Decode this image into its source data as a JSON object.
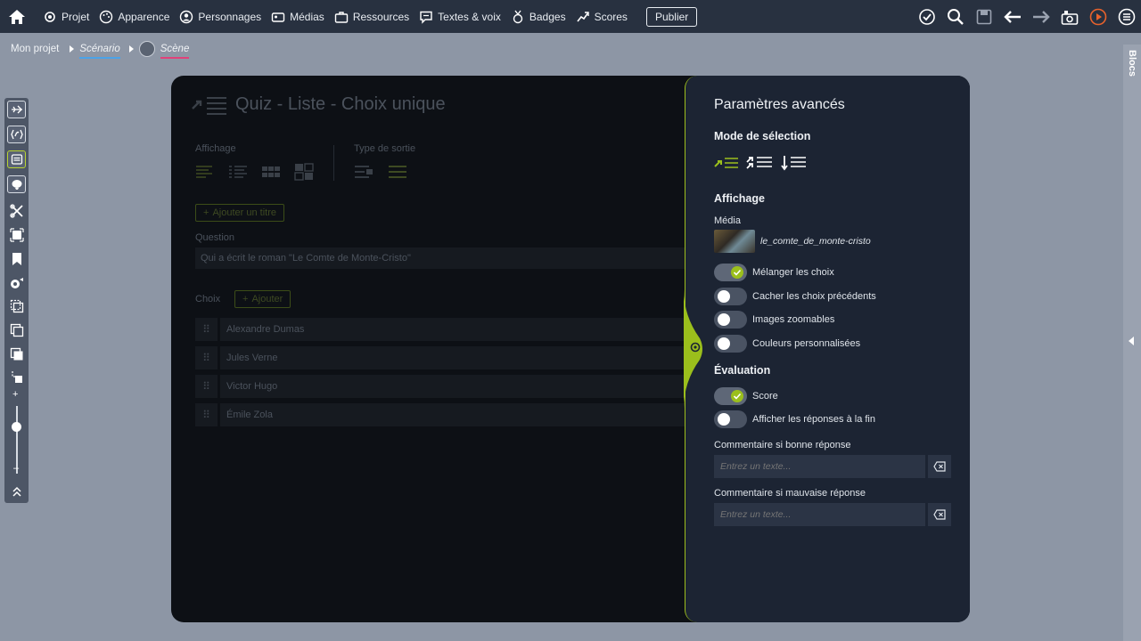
{
  "topbar": {
    "items": [
      {
        "label": "Projet",
        "icon": "gear-icon"
      },
      {
        "label": "Apparence",
        "icon": "palette-icon"
      },
      {
        "label": "Personnages",
        "icon": "person-icon"
      },
      {
        "label": "Médias",
        "icon": "media-icon"
      },
      {
        "label": "Ressources",
        "icon": "briefcase-icon"
      },
      {
        "label": "Textes & voix",
        "icon": "chat-icon"
      },
      {
        "label": "Badges",
        "icon": "badge-icon"
      },
      {
        "label": "Scores",
        "icon": "chart-icon"
      }
    ],
    "publish_label": "Publier"
  },
  "breadcrumb": {
    "project": "Mon projet",
    "scenario": "Scénario",
    "scene": "Scène"
  },
  "blocs_label": "Blocs",
  "editor": {
    "title": "Quiz - Liste - Choix unique",
    "affichage_label": "Affichage",
    "type_sortie_label": "Type de sortie",
    "add_title_label": "Ajouter un titre",
    "question_label": "Question",
    "question_value": "Qui a écrit le roman \"Le Comte de Monte-Cristo\"",
    "choix_label": "Choix",
    "add_label": "Ajouter",
    "choices": [
      "Alexandre Dumas",
      "Jules Verne",
      "Victor Hugo",
      "Émile Zola"
    ]
  },
  "advanced": {
    "title": "Paramètres avancés",
    "mode_selection": "Mode de sélection",
    "affichage": "Affichage",
    "media_label": "Média",
    "media_name": "le_comte_de_monte-cristo",
    "toggles": [
      {
        "label": "Mélanger les choix",
        "on": true
      },
      {
        "label": "Cacher les choix précédents",
        "on": false
      },
      {
        "label": "Images zoomables",
        "on": false
      },
      {
        "label": "Couleurs personnalisées",
        "on": false
      }
    ],
    "evaluation": "Évaluation",
    "eval_toggles": [
      {
        "label": "Score",
        "on": true
      },
      {
        "label": "Afficher les réponses à la fin",
        "on": false
      }
    ],
    "good_comment_label": "Commentaire si bonne réponse",
    "bad_comment_label": "Commentaire si mauvaise réponse",
    "input_placeholder": "Entrez un texte..."
  },
  "colors": {
    "accent": "#9bbf1c",
    "topbar": "#283140",
    "panel": "#1c2433"
  }
}
